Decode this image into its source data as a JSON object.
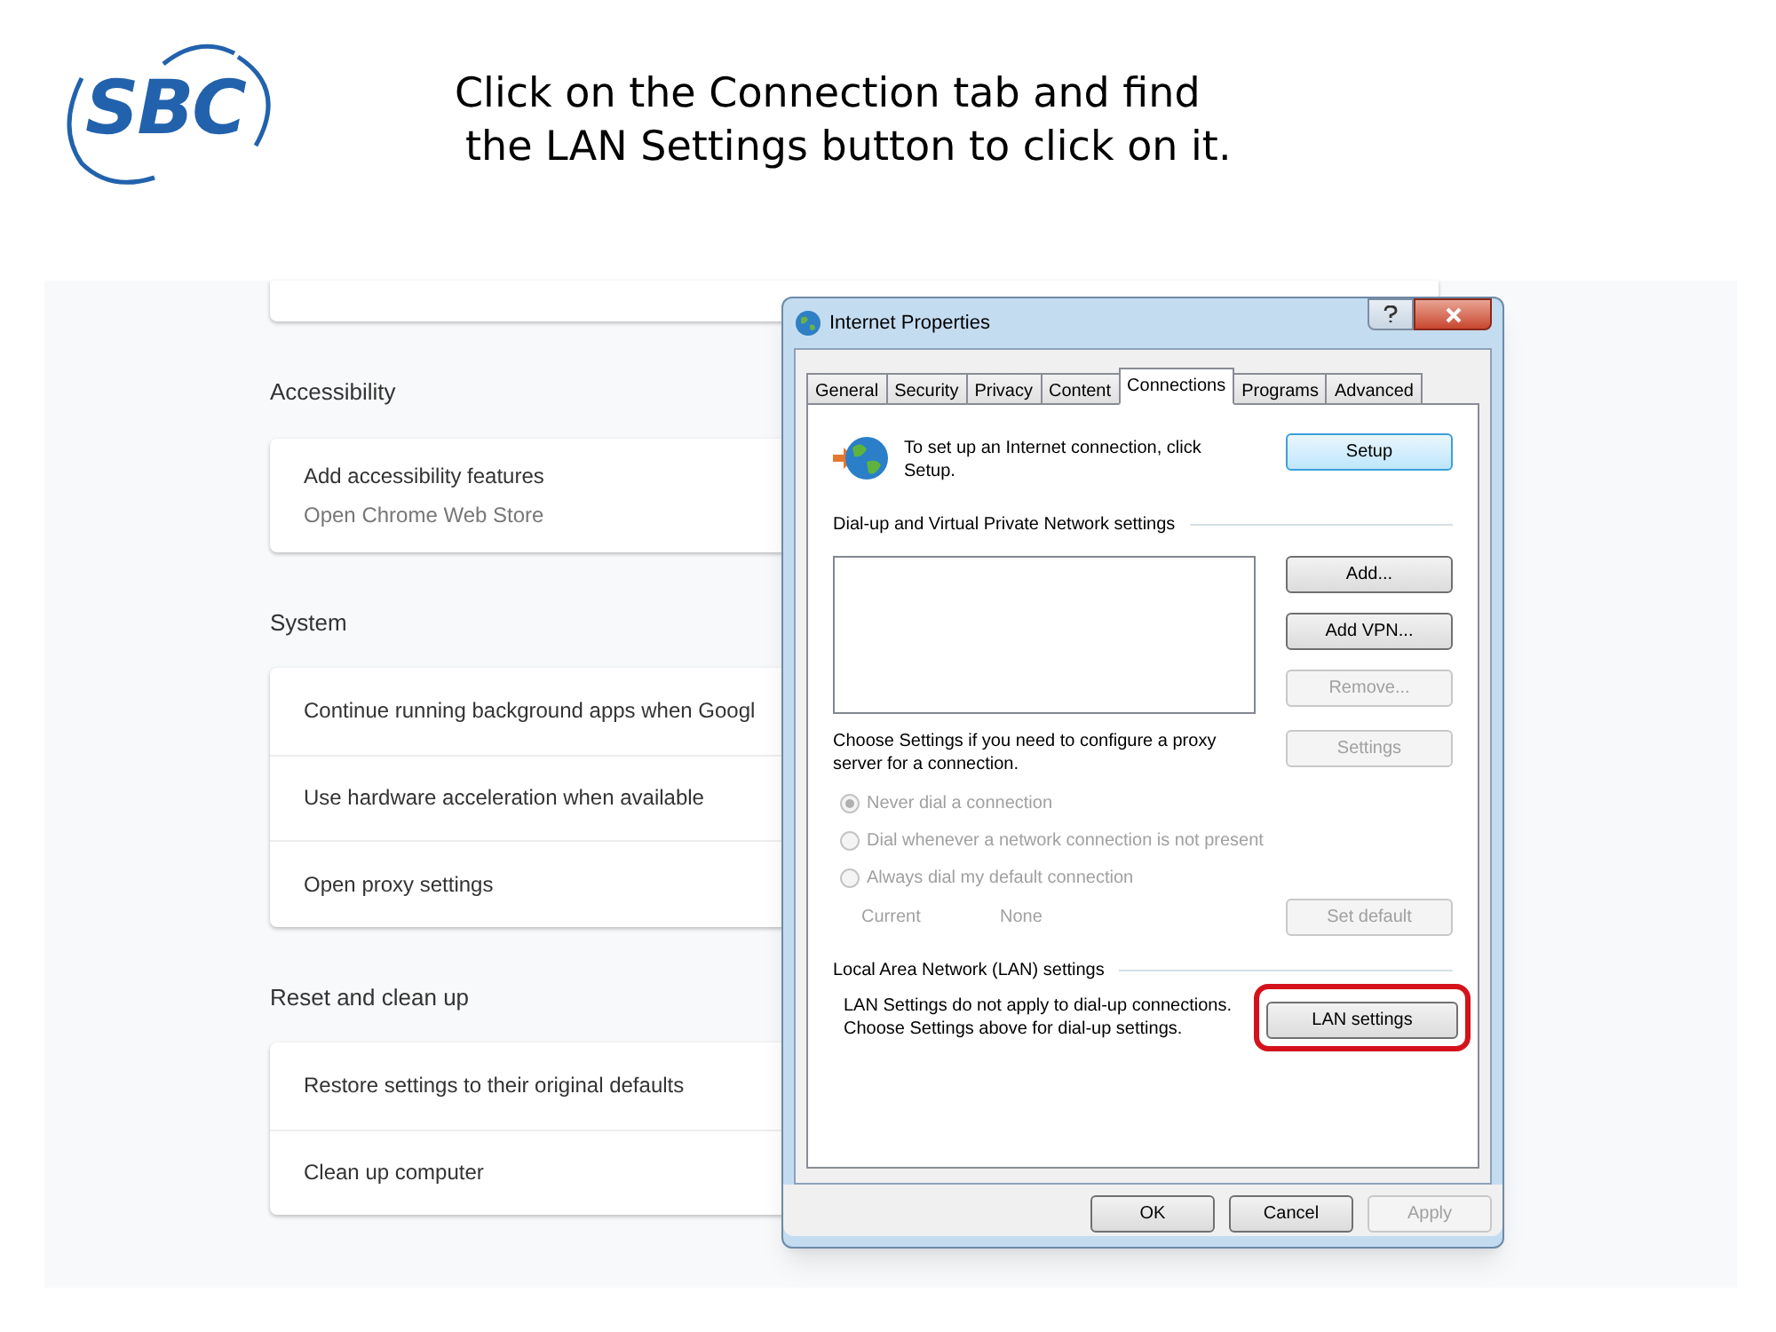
{
  "slide": {
    "logo": "SBC",
    "instruction_lines": [
      "Click on the Connection tab and find",
      "the LAN Settings button to click on it."
    ]
  },
  "settings": {
    "sections": [
      {
        "title": "Accessibility",
        "rows": [
          {
            "label": "Add accessibility features",
            "sublabel": "Open Chrome Web Store"
          }
        ]
      },
      {
        "title": "System",
        "rows": [
          {
            "label": "Continue running background apps when Googl"
          },
          {
            "label": "Use hardware acceleration when available"
          },
          {
            "label": "Open proxy settings"
          }
        ]
      },
      {
        "title": "Reset and clean up",
        "rows": [
          {
            "label": "Restore settings to their original defaults"
          },
          {
            "label": "Clean up computer"
          }
        ]
      }
    ]
  },
  "dialog": {
    "title": "Internet Properties",
    "tabs": [
      {
        "label": "General",
        "selected": false
      },
      {
        "label": "Security",
        "selected": false
      },
      {
        "label": "Privacy",
        "selected": false
      },
      {
        "label": "Content",
        "selected": false
      },
      {
        "label": "Connections",
        "selected": true
      },
      {
        "label": "Programs",
        "selected": false
      },
      {
        "label": "Advanced",
        "selected": false
      }
    ],
    "setup_text": "To set up an Internet connection, click Setup.",
    "setup_button": {
      "label": "Setup",
      "focused": true
    },
    "vpn_group_label": "Dial-up and Virtual Private Network settings",
    "vpn_buttons": [
      {
        "label": "Add...",
        "disabled": false
      },
      {
        "label": "Add VPN...",
        "disabled": false
      },
      {
        "label": "Remove...",
        "disabled": true
      }
    ],
    "proxy_text": "Choose Settings if you need to configure a proxy server for a connection.",
    "settings_button": {
      "label": "Settings",
      "disabled": true
    },
    "radios": [
      {
        "label": "Never dial a connection",
        "selected": true,
        "disabled": true
      },
      {
        "label": "Dial whenever a network connection is not present",
        "selected": false,
        "disabled": true
      },
      {
        "label": "Always dial my default connection",
        "selected": false,
        "disabled": true
      }
    ],
    "current_label": "Current",
    "current_value": "None",
    "set_default_button": {
      "label": "Set default",
      "disabled": true
    },
    "lan_group_label": "Local Area Network (LAN) settings",
    "lan_text": "LAN Settings do not apply to dial-up connections. Choose Settings above for dial-up settings.",
    "lan_button": {
      "label": "LAN settings",
      "highlighted": true
    },
    "footer_buttons": [
      {
        "label": "OK",
        "disabled": false
      },
      {
        "label": "Cancel",
        "disabled": false
      },
      {
        "label": "Apply",
        "disabled": true
      }
    ]
  }
}
